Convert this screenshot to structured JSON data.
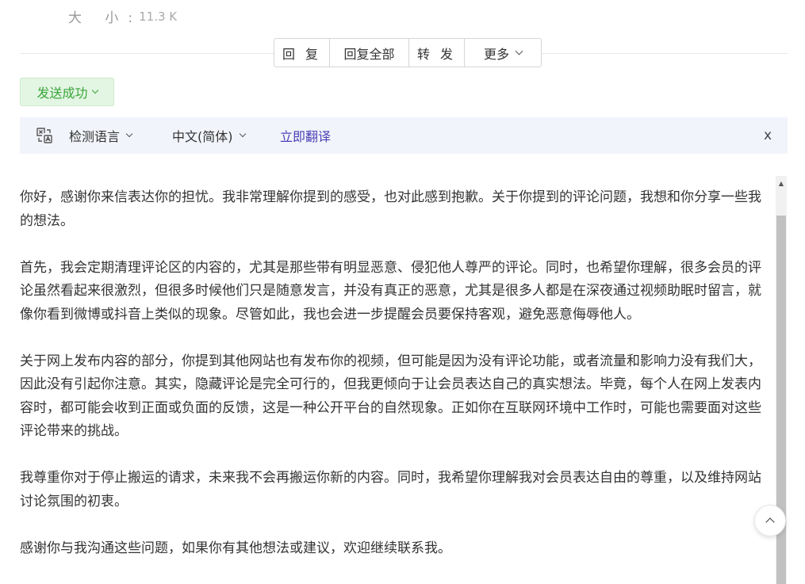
{
  "meta": {
    "size_label": "大 小:",
    "size_value": "11.3 K"
  },
  "actions": {
    "reply": "回 复",
    "reply_all": "回复全部",
    "forward": "转 发",
    "more": "更多"
  },
  "status": {
    "send_success": "发送成功"
  },
  "translate": {
    "source_language": "检测语言",
    "target_language": "中文(简体)",
    "translate_now": "立即翻译",
    "close": "x"
  },
  "message": {
    "paragraphs": [
      "你好，感谢你来信表达你的担忧。我非常理解你提到的感受，也对此感到抱歉。关于你提到的评论问题，我想和你分享一些我的想法。",
      "首先，我会定期清理评论区的内容的，尤其是那些带有明显恶意、侵犯他人尊严的评论。同时，也希望你理解，很多会员的评论虽然看起来很激烈，但很多时候他们只是随意发言，并没有真正的恶意，尤其是很多人都是在深夜通过视频助眠时留言，就像你看到微博或抖音上类似的现象。尽管如此，我也会进一步提醒会员要保持客观，避免恶意侮辱他人。",
      "关于网上发布内容的部分，你提到其他网站也有发布你的视频，但可能是因为没有评论功能，或者流量和影响力没有我们大，因此没有引起你注意。其实，隐藏评论是完全可行的，但我更倾向于让会员表达自己的真实想法。毕竟，每个人在网上发表内容时，都可能会收到正面或负面的反馈，这是一种公开平台的自然现象。正如你在互联网环境中工作时，可能也需要面对这些评论带来的挑战。",
      "我尊重你对于停止搬运的请求，未来我不会再搬运你新的内容。同时，我希望你理解我对会员表达自由的尊重，以及维持网站讨论氛围的初衷。",
      "感谢你与我沟通这些问题，如果你有其他想法或建议，欢迎继续联系我。"
    ]
  },
  "icons": {
    "translate": "translate-icon",
    "chevron": "chevron-down-icon",
    "back_to_top": "chevron-up-icon"
  },
  "colors": {
    "success_text": "#3aa63a",
    "success_bg": "#e3f5e3",
    "translate_bar_bg": "#f2f4fb",
    "translate_link": "#4b3fb5"
  }
}
